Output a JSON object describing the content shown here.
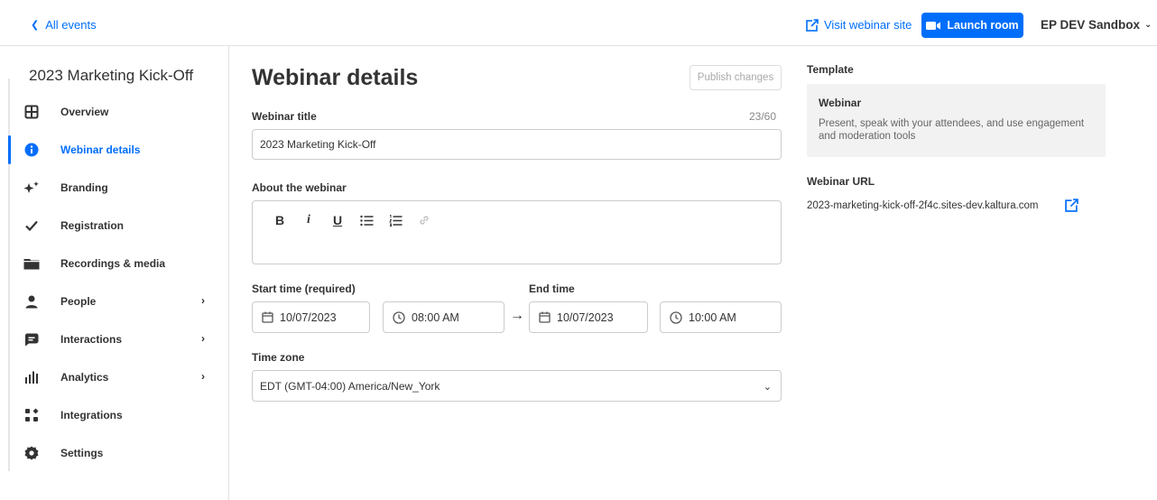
{
  "topbar": {
    "back_label": "All events",
    "visit_label": "Visit webinar site",
    "launch_label": "Launch room",
    "account_label": "EP DEV Sandbox"
  },
  "sidebar": {
    "event_title": "2023 Marketing Kick-Off",
    "items": [
      {
        "label": "Overview",
        "icon": "grid-icon",
        "active": false,
        "has_arrow": false
      },
      {
        "label": "Webinar details",
        "icon": "info-icon",
        "active": true,
        "has_arrow": false
      },
      {
        "label": "Branding",
        "icon": "sparkle-icon",
        "active": false,
        "has_arrow": false
      },
      {
        "label": "Registration",
        "icon": "check-icon",
        "active": false,
        "has_arrow": false
      },
      {
        "label": "Recordings & media",
        "icon": "folder-icon",
        "active": false,
        "has_arrow": false
      },
      {
        "label": "People",
        "icon": "person-icon",
        "active": false,
        "has_arrow": true
      },
      {
        "label": "Interactions",
        "icon": "chat-icon",
        "active": false,
        "has_arrow": true
      },
      {
        "label": "Analytics",
        "icon": "bar-chart-icon",
        "active": false,
        "has_arrow": true
      },
      {
        "label": "Integrations",
        "icon": "integrations-icon",
        "active": false,
        "has_arrow": false
      },
      {
        "label": "Settings",
        "icon": "gear-icon",
        "active": false,
        "has_arrow": false
      }
    ]
  },
  "main": {
    "page_title": "Webinar details",
    "publish_label": "Publish changes",
    "title_label": "Webinar title",
    "title_counter": "23/60",
    "title_value": "2023 Marketing Kick-Off",
    "about_label": "About the webinar",
    "toolbar": {
      "bold": "B",
      "italic": "i",
      "underline": "U"
    },
    "start_label": "Start time (required)",
    "end_label": "End time",
    "start_date": "10/07/2023",
    "start_time": "08:00 AM",
    "end_date": "10/07/2023",
    "end_time": "10:00 AM",
    "timezone_label": "Time zone",
    "timezone_value": "EDT (GMT-04:00) America/New_York"
  },
  "right": {
    "template_label": "Template",
    "template_name": "Webinar",
    "template_desc": "Present, speak with your attendees, and use engagement and moderation tools",
    "url_label": "Webinar URL",
    "url_value": "2023-marketing-kick-off-2f4c.sites-dev.kaltura.com"
  },
  "colors": {
    "accent": "#006efa",
    "border": "#cccccc",
    "card_bg": "#f2f2f2"
  }
}
